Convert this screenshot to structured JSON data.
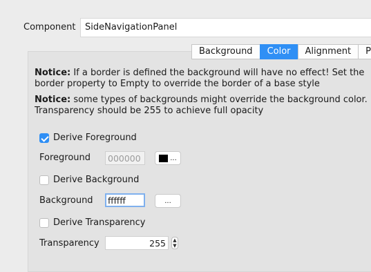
{
  "component": {
    "label": "Component",
    "value": "SideNavigationPanel"
  },
  "tabs": [
    {
      "label": "Background"
    },
    {
      "label": "Color"
    },
    {
      "label": "Alignment"
    },
    {
      "label": "Pa"
    }
  ],
  "notices": [
    {
      "title": "Notice:",
      "text": " If a border is defined the background will have no effect! Set the border property to Empty to override the border of a base style"
    },
    {
      "title": "Notice:",
      "text": " some types of backgrounds might override the background color. Transparency should be 255 to achieve full opacity"
    }
  ],
  "derive_foreground": {
    "label": "Derive Foreground",
    "checked": true
  },
  "foreground": {
    "label": "Foreground",
    "value": "000000",
    "swatch_color": "#000000",
    "button_label": "..."
  },
  "derive_background": {
    "label": "Derive Background",
    "checked": false
  },
  "background": {
    "label": "Background",
    "value": "ffffff",
    "button_label": "..."
  },
  "derive_transparency": {
    "label": "Derive Transparency",
    "checked": false
  },
  "transparency": {
    "label": "Transparency",
    "value": "255",
    "spinner_up": "▲",
    "spinner_down": "▼"
  },
  "colors": {
    "accent": "#2f8ff5",
    "panel": "#e3e3e3",
    "window": "#ececec"
  }
}
